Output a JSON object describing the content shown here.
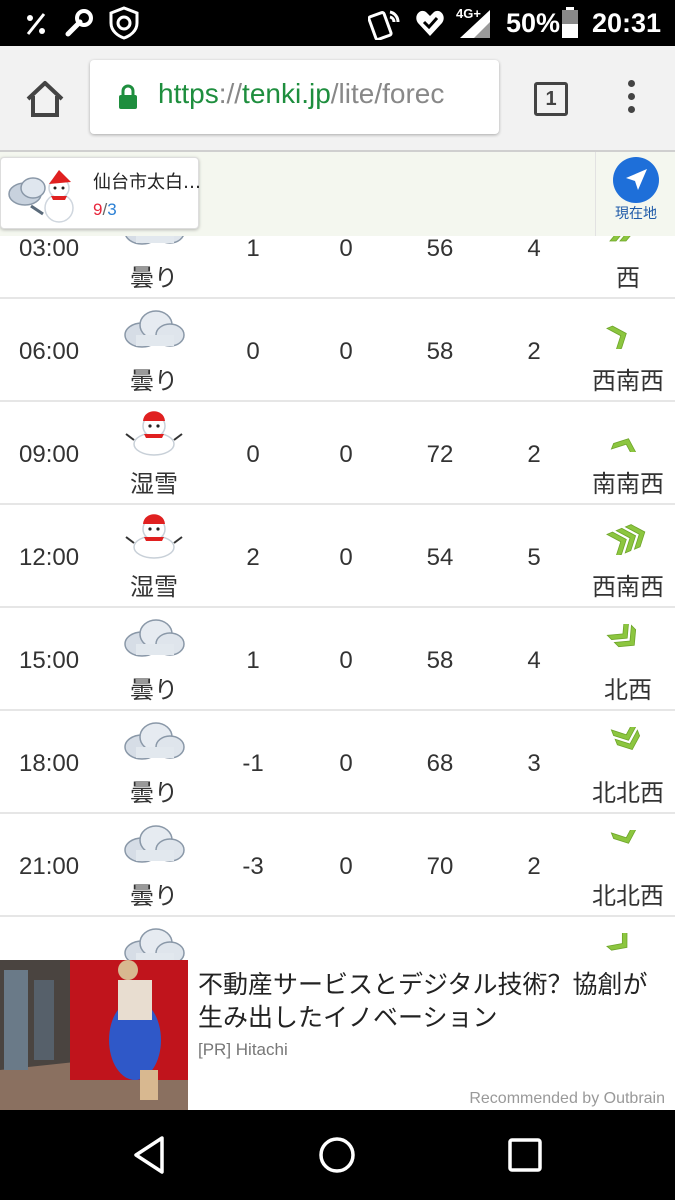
{
  "status_bar": {
    "network": "4G+",
    "battery": "50%",
    "time": "20:31"
  },
  "browser": {
    "url_scheme": "https",
    "url_sep": "://",
    "url_host": "tenki.jp",
    "url_path": "/lite/forec",
    "tab_count": "1"
  },
  "location": {
    "name": "仙台市太白…",
    "temp_max": "9",
    "temp_sep": "/",
    "temp_min": "3",
    "current_location_label": "現在地"
  },
  "forecast": [
    {
      "time": "03:00",
      "weather": "曇り",
      "temp": "1",
      "precip": "0",
      "humidity": "56",
      "wind_speed": "4",
      "wind_dir": "西",
      "icon": "cloud-icon"
    },
    {
      "time": "06:00",
      "weather": "曇り",
      "temp": "0",
      "precip": "0",
      "humidity": "58",
      "wind_speed": "2",
      "wind_dir": "西南西",
      "icon": "cloud-icon"
    },
    {
      "time": "09:00",
      "weather": "湿雪",
      "temp": "0",
      "precip": "0",
      "humidity": "72",
      "wind_speed": "2",
      "wind_dir": "南南西",
      "icon": "snowman-icon"
    },
    {
      "time": "12:00",
      "weather": "湿雪",
      "temp": "2",
      "precip": "0",
      "humidity": "54",
      "wind_speed": "5",
      "wind_dir": "西南西",
      "icon": "snowman-icon"
    },
    {
      "time": "15:00",
      "weather": "曇り",
      "temp": "1",
      "precip": "0",
      "humidity": "58",
      "wind_speed": "4",
      "wind_dir": "北西",
      "icon": "cloud-icon"
    },
    {
      "time": "18:00",
      "weather": "曇り",
      "temp": "-1",
      "precip": "0",
      "humidity": "68",
      "wind_speed": "3",
      "wind_dir": "北北西",
      "icon": "cloud-icon"
    },
    {
      "time": "21:00",
      "weather": "曇り",
      "temp": "-3",
      "precip": "0",
      "humidity": "70",
      "wind_speed": "2",
      "wind_dir": "北北西",
      "icon": "cloud-icon"
    }
  ],
  "ad": {
    "title": "不動産サービスとデジタル技術？協創が生み出したイノベーション",
    "source": "[PR]  Hitachi",
    "recommended": "Recommended by Outbrain"
  },
  "colors": {
    "url_green": "#1e8e3e",
    "temp_max": "#e8263c",
    "temp_min": "#2a7fd4",
    "wind_arrow": "#8cc63f",
    "current_location": "#1e6fd9"
  }
}
